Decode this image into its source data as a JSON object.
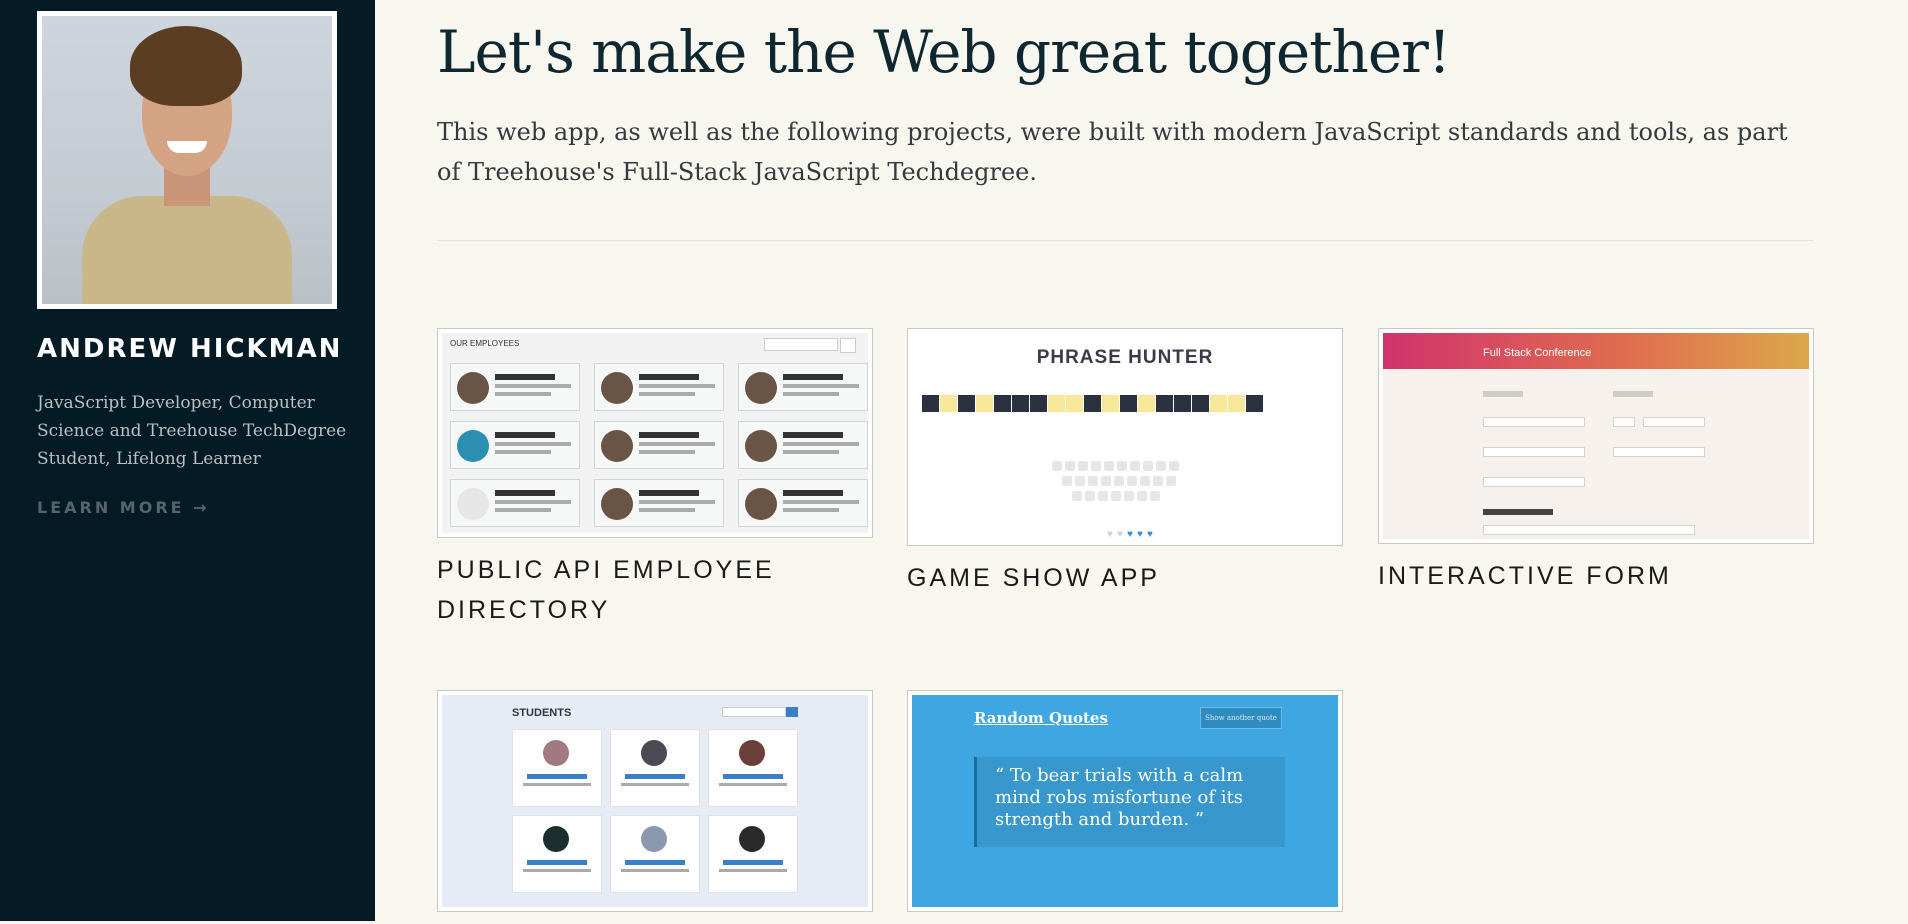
{
  "sidebar": {
    "name": "ANDREW HICKMAN",
    "bio": "JavaScript Developer, Computer Science and Treehouse TechDegree Student, Lifelong Learner",
    "learn_more": "LEARN MORE →"
  },
  "main": {
    "title": "Let's make the Web great together!",
    "intro": "This web app, as well as the following projects, were built with modern JavaScript standards and tools, as part of Treehouse's Full-Stack JavaScript Techdegree."
  },
  "projects": [
    {
      "caption": "PUBLIC API EMPLOYEE DIRECTORY",
      "thumb_header": "OUR EMPLOYEES"
    },
    {
      "caption": "GAME SHOW APP",
      "thumb_header": "PHRASE HUNTER"
    },
    {
      "caption": "INTERACTIVE FORM",
      "thumb_header": "Full Stack Conference"
    },
    {
      "caption": "",
      "thumb_header": "STUDENTS"
    },
    {
      "caption": "",
      "thumb_header": "Random Quotes",
      "thumb_button": "Show another quote",
      "thumb_quote": "“ To bear trials with a calm mind robs misfortune of its strength and burden. ”"
    }
  ],
  "colors": {
    "sidebar_bg": "#041a24",
    "page_bg": "#f7f6ef",
    "heading": "#0e2731"
  }
}
